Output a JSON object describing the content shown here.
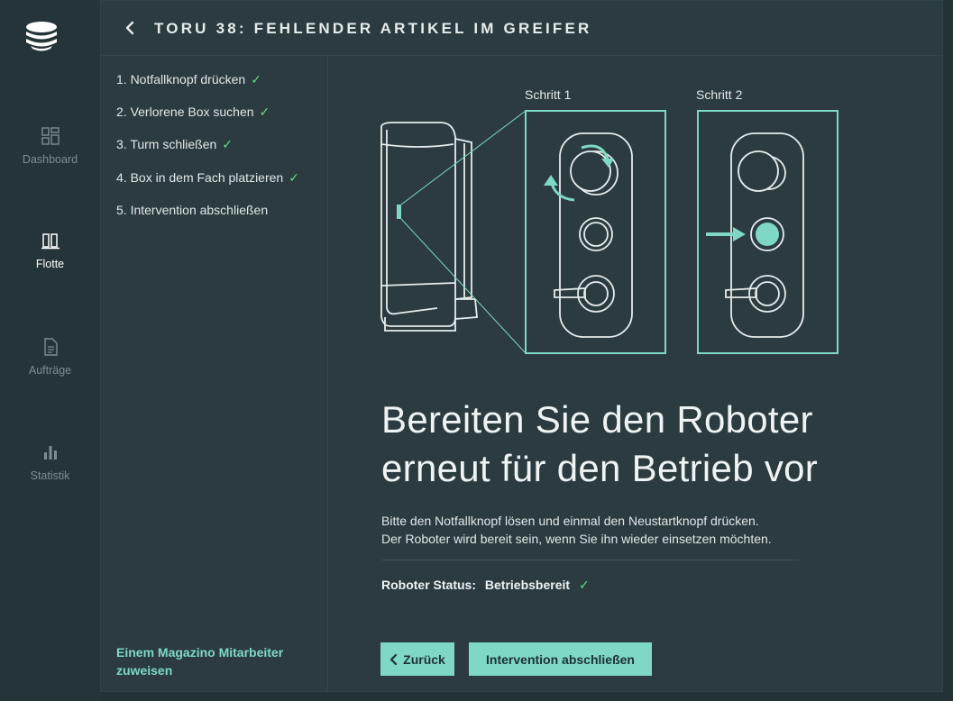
{
  "nav": {
    "items": [
      {
        "label": "Dashboard",
        "icon": "dashboard-grid-icon",
        "active": false
      },
      {
        "label": "Flotte",
        "icon": "fleet-icon",
        "active": true
      },
      {
        "label": "Aufträge",
        "icon": "document-icon",
        "active": false
      },
      {
        "label": "Statistik",
        "icon": "bar-chart-icon",
        "active": false
      }
    ]
  },
  "header": {
    "title": "TORU 38: FEHLENDER ARTIKEL IM GREIFER",
    "back_icon": "chevron-left-icon"
  },
  "steps": [
    {
      "label": "1. Notfallknopf drücken",
      "done": true
    },
    {
      "label": "2. Verlorene Box suchen",
      "done": true
    },
    {
      "label": "3. Turm schließen",
      "done": true
    },
    {
      "label": "4. Box in dem Fach platzieren",
      "done": true
    },
    {
      "label": "5. Intervention abschließen",
      "done": false
    }
  ],
  "check_mark": "✓",
  "assign_link": "Einem Magazino Mitarbeiter zuweisen",
  "illustration": {
    "step1_label": "Schritt 1",
    "step2_label": "Schritt 2"
  },
  "main": {
    "heading": "Bereiten Sie den Roboter erneut für den Betrieb vor",
    "description_line1": "Bitte den Notfallknopf lösen und einmal den Neustartknopf drücken.",
    "description_line2": "Der Roboter wird bereit sein, wenn Sie ihn wieder einsetzen möchten.",
    "status_label": "Roboter Status:",
    "status_value": "Betriebsbereit"
  },
  "buttons": {
    "back_label": "Zurück",
    "finish_label": "Intervention abschließen"
  },
  "colors": {
    "accent": "#7fd9c2",
    "check": "#5fe08c",
    "background": "#2b3b3f"
  }
}
